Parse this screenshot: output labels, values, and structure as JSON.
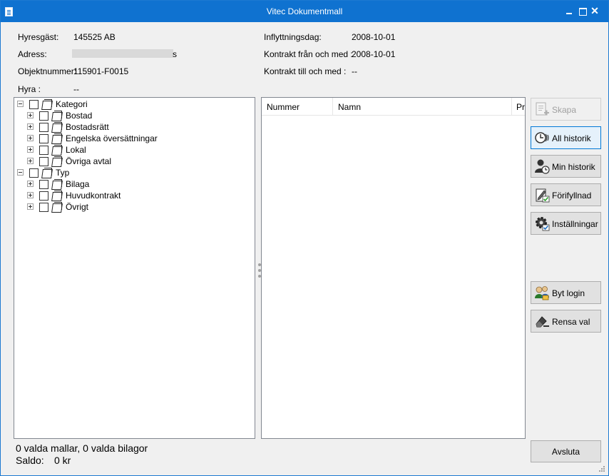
{
  "window": {
    "title": "Vitec Dokumentmall"
  },
  "info": {
    "hyresgast_label": "Hyresgäst:",
    "hyresgast_value": "145525 AB",
    "adress_label": "Adress:",
    "adress_value": "s",
    "objektnummer_label": "Objektnummer:",
    "objektnummer_value": "115901-F0015",
    "hyra_label": "Hyra :",
    "hyra_value": "--",
    "inflyttningsdag_label": "Inflyttningsdag:",
    "inflyttningsdag_value": "2008-10-01",
    "kontrakt_fran_label": "Kontrakt från och med :",
    "kontrakt_fran_value": "2008-10-01",
    "kontrakt_till_label": "Kontrakt till och med :",
    "kontrakt_till_value": "--"
  },
  "tree": {
    "nodes": [
      {
        "label": "Kategori",
        "level": 0,
        "expanded": true
      },
      {
        "label": "Bostad",
        "level": 1,
        "expanded": false
      },
      {
        "label": "Bostadsrätt",
        "level": 1,
        "expanded": false
      },
      {
        "label": "Engelska översättningar",
        "level": 1,
        "expanded": false
      },
      {
        "label": "Lokal",
        "level": 1,
        "expanded": false
      },
      {
        "label": "Övriga avtal",
        "level": 1,
        "expanded": false
      },
      {
        "label": "Typ",
        "level": 0,
        "expanded": true
      },
      {
        "label": "Bilaga",
        "level": 1,
        "expanded": false
      },
      {
        "label": "Huvudkontrakt",
        "level": 1,
        "expanded": false
      },
      {
        "label": "Övrigt",
        "level": 1,
        "expanded": false
      }
    ]
  },
  "list": {
    "columns": [
      "Nummer",
      "Namn",
      "Pri"
    ]
  },
  "buttons": {
    "skapa": "Skapa",
    "all_historik": "All historik",
    "min_historik": "Min historik",
    "forifyllnad": "Förifyllnad",
    "installningar": "Inställningar",
    "byt_login": "Byt login",
    "rensa_val": "Rensa val",
    "avsluta": "Avsluta"
  },
  "status": {
    "selection": "0 valda mallar, 0 valda bilagor",
    "saldo_label": "Saldo:",
    "saldo_value": "0 kr"
  },
  "colors": {
    "titlebar": "#0f72d0",
    "accent": "#0078d7"
  }
}
